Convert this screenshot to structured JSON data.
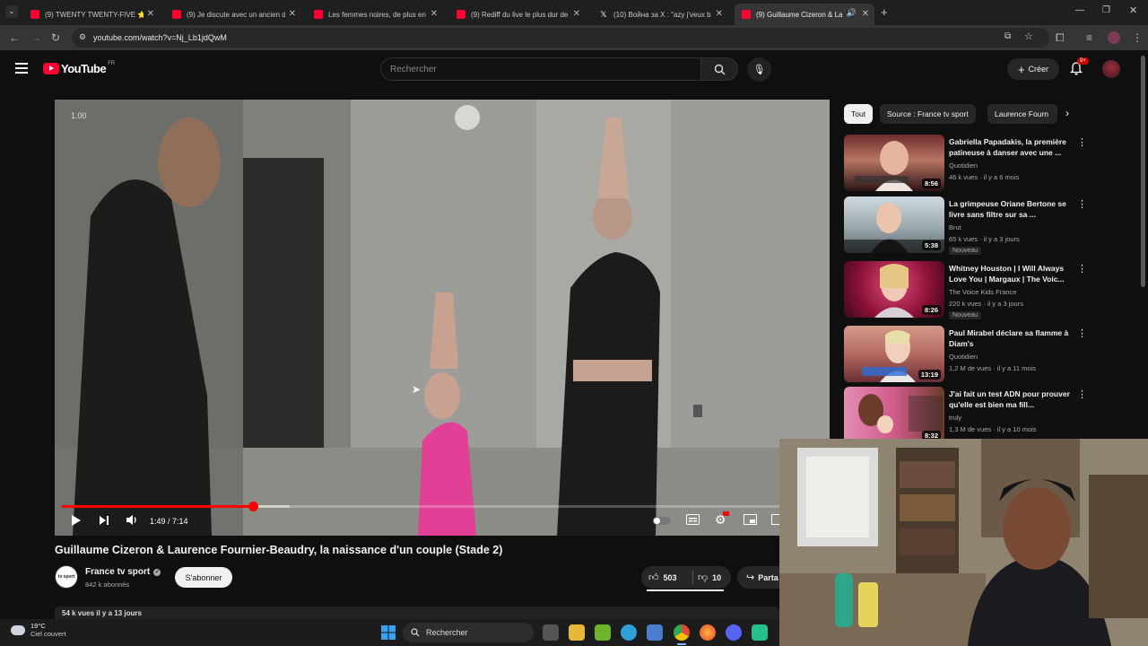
{
  "browser": {
    "tabs": [
      {
        "title": "(9) TWENTY TWENTY-FIVE ⭐"
      },
      {
        "title": "(9) Je discute avec un ancien de"
      },
      {
        "title": "Les femmes noires, de plus en"
      },
      {
        "title": "(9) Rediff du live le plus dur de"
      },
      {
        "title": "(10) Война за X : \"azy j'veux b"
      },
      {
        "title": "(9) Guillaume Cizeron & La"
      }
    ],
    "url": "youtube.com/watch?v=Nj_Lb1jdQwM"
  },
  "header": {
    "logo_text": "YouTube",
    "country": "FR",
    "search_placeholder": "Rechercher",
    "create_label": "Créer",
    "notif_count": "9+"
  },
  "player": {
    "speed_overlay": "1.00",
    "time": "1:49 / 7:14",
    "progress": 0.251,
    "buffered": 0.3
  },
  "video": {
    "title": "Guillaume Cizeron & Laurence Fournier-Beaudry, la naissance d'un couple (Stade 2)",
    "channel": "France tv sport",
    "subscribers": "842 k abonnés",
    "subscribe_label": "S'abonner",
    "likes": "503",
    "dislikes": "10",
    "share_label": "Parta",
    "views_date": "54 k vues  il y a 13 jours",
    "channel_avatar_text": "tv sport"
  },
  "sidebar": {
    "chips": [
      "Tout",
      "Source : France tv sport",
      "Laurence Fourn"
    ],
    "recommendations": [
      {
        "title": "Gabriella Papadakis, la première patineuse à danser avec une ...",
        "channel": "Quotidien",
        "meta": "46 k vues · il y a 6 mois",
        "duration": "8:56",
        "badge": ""
      },
      {
        "title": "La grimpeuse Oriane Bertone se livre sans filtre sur sa ...",
        "channel": "Brut",
        "meta": "65 k vues · il y a 3 jours",
        "duration": "5:38",
        "badge": "Nouveau"
      },
      {
        "title": "Whitney Houston | I Will Always Love You | Margaux | The Voic...",
        "channel": "The Voice Kids France",
        "meta": "220 k vues · il y a 3 jours",
        "duration": "8:26",
        "badge": "Nouveau"
      },
      {
        "title": "Paul Mirabel déclare sa flamme à Diam's",
        "channel": "Quotidien",
        "meta": "1,2 M de vues · il y a 11 mois",
        "duration": "13:19",
        "badge": ""
      },
      {
        "title": "J'ai fait un test ADN pour prouver qu'elle est bien ma fill...",
        "channel": "truly",
        "meta": "1,3 M de vues · il y a 10 mois",
        "duration": "8:32",
        "badge": ""
      }
    ]
  },
  "taskbar": {
    "temperature": "19°C",
    "weather": "Ciel couvert",
    "search_label": "Rechercher"
  },
  "colors": {
    "accent": "#ff0000",
    "background": "#0f0f0f"
  }
}
